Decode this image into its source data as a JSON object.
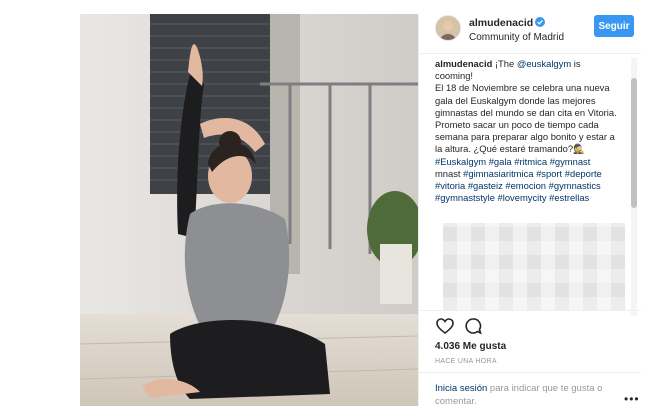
{
  "post": {
    "username": "almudenacid",
    "location": "Community of Madrid",
    "follow_label": "Seguir",
    "caption_lines": [
      [
        {
          "t": "almudenacid",
          "k": "user"
        },
        {
          "t": " ¡The ",
          "k": "text"
        },
        {
          "t": "@euskalgym",
          "k": "tag"
        },
        {
          "t": " is",
          "k": "text"
        }
      ],
      [
        {
          "t": "cooming!",
          "k": "text"
        }
      ],
      [
        {
          "t": "El 18 de Noviembre se celebra una nueva",
          "k": "text"
        }
      ],
      [
        {
          "t": "gala del Euskalgym donde las mejores",
          "k": "text"
        }
      ],
      [
        {
          "t": "gimnastas del mundo se dan cita en Vitoria.",
          "k": "text"
        }
      ],
      [
        {
          "t": "Prometo sacar un poco de tiempo cada",
          "k": "text"
        }
      ],
      [
        {
          "t": "semana para preparar algo bonito y estar a",
          "k": "text"
        }
      ],
      [
        {
          "t": "la altura. ¿Qué estaré tramando?🕵",
          "k": "text"
        }
      ],
      [
        {
          "t": "#Euskalgym",
          "k": "tag"
        },
        {
          "t": " ",
          "k": "text"
        },
        {
          "t": "#gala",
          "k": "tag"
        },
        {
          "t": " ",
          "k": "text"
        },
        {
          "t": "#ritmica",
          "k": "tag"
        },
        {
          "t": " ",
          "k": "text"
        },
        {
          "t": "#gymnast",
          "k": "tag"
        }
      ],
      [
        {
          "t": "mnast",
          "k": "text"
        },
        {
          "t": " ",
          "k": "text"
        },
        {
          "t": "#gimnasiaritmica",
          "k": "tag"
        },
        {
          "t": " ",
          "k": "text"
        },
        {
          "t": "#sport",
          "k": "tag"
        },
        {
          "t": " ",
          "k": "text"
        },
        {
          "t": "#deporte",
          "k": "tag"
        }
      ],
      [
        {
          "t": "#vitoria",
          "k": "tag"
        },
        {
          "t": " ",
          "k": "text"
        },
        {
          "t": "#gasteiz",
          "k": "tag"
        },
        {
          "t": " ",
          "k": "text"
        },
        {
          "t": "#emocion",
          "k": "tag"
        },
        {
          "t": " ",
          "k": "text"
        },
        {
          "t": "#gymnastics",
          "k": "tag"
        }
      ],
      [
        {
          "t": "#gymnaststyle",
          "k": "tag"
        },
        {
          "t": " ",
          "k": "text"
        },
        {
          "t": "#lovemycity",
          "k": "tag"
        },
        {
          "t": " ",
          "k": "text"
        },
        {
          "t": "#estrellas",
          "k": "tag"
        }
      ]
    ],
    "likes": "4.036 Me gusta",
    "time": "HACE UNA HORA",
    "login_link": "Inicia sesión",
    "login_rest": " para indicar que te gusta o comentar.",
    "more": "•••"
  },
  "icons": {
    "verified": "verified-badge-icon",
    "like": "heart-icon",
    "comment": "comment-bubble-icon"
  },
  "colors": {
    "accent": "#3897f0",
    "link": "#003569",
    "muted": "#999999"
  }
}
